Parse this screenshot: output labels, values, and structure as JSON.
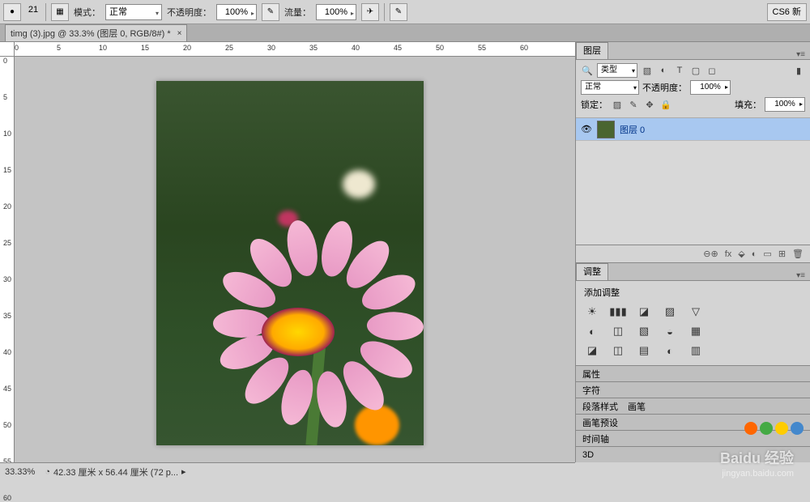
{
  "options": {
    "brush_size": "21",
    "mode_label": "模式：",
    "mode_value": "正常",
    "opacity_label": "不透明度：",
    "opacity_value": "100%",
    "flow_label": "流量：",
    "flow_value": "100%",
    "cs6_label": "CS6 新"
  },
  "tab": {
    "title": "timg (3).jpg @ 33.3% (图层 0, RGB/8#) *",
    "close": "×"
  },
  "ruler_h": [
    "0",
    "5",
    "10",
    "15",
    "20",
    "25",
    "30",
    "35",
    "40",
    "45",
    "50",
    "55",
    "60"
  ],
  "ruler_v": [
    "0",
    "5",
    "10",
    "15",
    "20",
    "25",
    "30",
    "35",
    "40",
    "45",
    "50",
    "55",
    "60"
  ],
  "panels": {
    "layers_tab": "图层",
    "filter_label": "类型",
    "blend_mode": "正常",
    "opacity_label": "不透明度：",
    "opacity_value": "100%",
    "lock_label": "锁定：",
    "fill_label": "填充：",
    "fill_value": "100%",
    "layer0_name": "图层 0",
    "footer_icons": [
      "⊖⊕",
      "fx",
      "⬙",
      "◐",
      "▭",
      "⊞",
      "🗑"
    ],
    "adjust_tab": "调整",
    "adjust_title": "添加调整",
    "adj_icons_r1": [
      "☀",
      "▮▮▮",
      "◪",
      "▨",
      "▽"
    ],
    "adj_icons_r2": [
      "◐",
      "◫",
      "▧",
      "◒",
      "▦"
    ],
    "adj_icons_r3": [
      "◪",
      "◫",
      "▤",
      "◐",
      "▥"
    ],
    "props_tab": "属性",
    "char_tab": "字符",
    "para_tab": "段落样式",
    "brush_tab": "画笔预设",
    "misc_tab": "画笔",
    "timeline_tab": "时间轴",
    "d3_tab": "3D"
  },
  "status": {
    "zoom": "33.33%",
    "size": "42.33 厘米 x 56.44 厘米 (72 p...",
    "arrow": "▸"
  },
  "watermark": {
    "brand": "Baidu 经验",
    "url": "jingyan.baidu.com"
  }
}
